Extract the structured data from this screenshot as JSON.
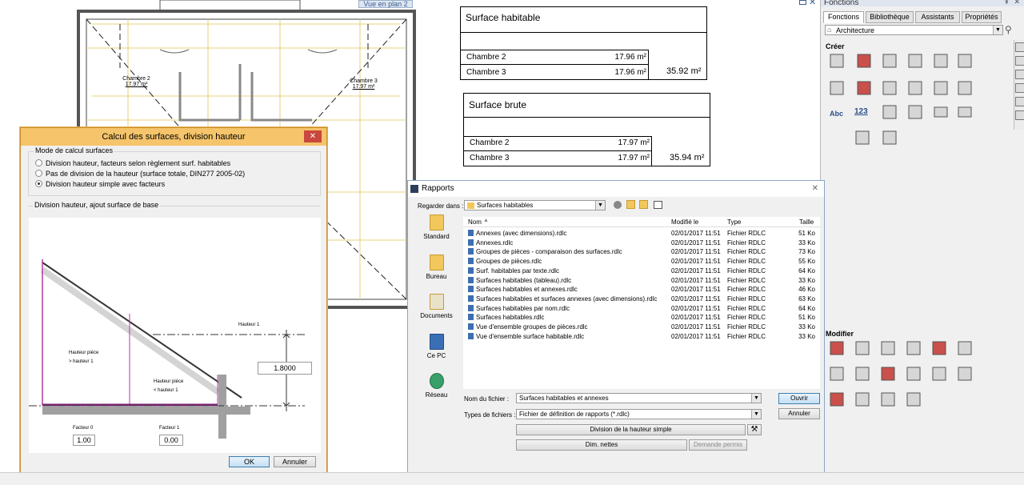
{
  "cad": {
    "view_tag": "Vue en plan 2",
    "rooms": [
      {
        "name": "Chambre 2",
        "area": "17.97 m²"
      },
      {
        "name": "Chambre 3",
        "area": "17.97 m²"
      }
    ],
    "table_habitable": {
      "title": "Surface habitable",
      "rows": [
        {
          "label": "Chambre 2",
          "value": "17.96 m²"
        },
        {
          "label": "Chambre 3",
          "value": "17.96 m²"
        }
      ],
      "total": "35.92 m²"
    },
    "table_brute": {
      "title": "Surface brute",
      "rows": [
        {
          "label": "Chambre 2",
          "value": "17.97 m²"
        },
        {
          "label": "Chambre 3",
          "value": "17.97 m²"
        }
      ],
      "total": "35.94 m²"
    }
  },
  "panel": {
    "title": "Fonctions",
    "tabs": [
      "Fonctions",
      "Bibliothèque",
      "Assistants",
      "Propriétés"
    ],
    "category": "Architecture",
    "create_label": "Créer",
    "modify_label": "Modifier",
    "abc_label": "Abc",
    "num_label": "123"
  },
  "dialog1": {
    "title": "Calcul des surfaces, division hauteur",
    "mode_group": "Mode de calcul surfaces",
    "options": [
      "Division hauteur, facteurs selon règlement surf. habitables",
      "Pas de division de la hauteur (surface totale, DIN277 2005-02)",
      "Division hauteur simple avec facteurs"
    ],
    "selected_option": 2,
    "group2": "Division hauteur, ajout surface de base",
    "hauteur1_label": "Hauteur 1",
    "hauteur1_value": "1.8000",
    "piece_gt_label1": "Hauteur pièce",
    "piece_gt_label2": "> hauteur 1",
    "piece_lt_label1": "Hauteur pièce",
    "piece_lt_label2": "< hauteur 1",
    "facteur0_label": "Facteur 0",
    "facteur0_value": "1.00",
    "facteur1_label": "Facteur 1",
    "facteur1_value": "0.00",
    "ok": "OK",
    "cancel": "Annuler"
  },
  "dialog2": {
    "title": "Rapports",
    "look_in_label": "Regarder dans :",
    "look_in_value": "Surfaces habitables",
    "places": [
      "Standard",
      "Bureau",
      "Documents",
      "Ce PC",
      "Réseau"
    ],
    "columns": [
      "Nom",
      "Modifié le",
      "Type",
      "Taille"
    ],
    "files": [
      {
        "name": "Annexes (avec dimensions).rdlc",
        "date": "02/01/2017 11:51",
        "type": "Fichier RDLC",
        "size": "51 Ko"
      },
      {
        "name": "Annexes.rdlc",
        "date": "02/01/2017 11:51",
        "type": "Fichier RDLC",
        "size": "33 Ko"
      },
      {
        "name": "Groupes de pièces - comparaison des surfaces.rdlc",
        "date": "02/01/2017 11:51",
        "type": "Fichier RDLC",
        "size": "73 Ko"
      },
      {
        "name": "Groupes de pièces.rdlc",
        "date": "02/01/2017 11:51",
        "type": "Fichier RDLC",
        "size": "55 Ko"
      },
      {
        "name": "Surf. habitables par texte.rdlc",
        "date": "02/01/2017 11:51",
        "type": "Fichier RDLC",
        "size": "64 Ko"
      },
      {
        "name": "Surfaces habitables (tableau).rdlc",
        "date": "02/01/2017 11:51",
        "type": "Fichier RDLC",
        "size": "33 Ko"
      },
      {
        "name": "Surfaces habitables et annexes.rdlc",
        "date": "02/01/2017 11:51",
        "type": "Fichier RDLC",
        "size": "46 Ko"
      },
      {
        "name": "Surfaces habitables et surfaces annexes (avec dimensions).rdlc",
        "date": "02/01/2017 11:51",
        "type": "Fichier RDLC",
        "size": "63 Ko"
      },
      {
        "name": "Surfaces habitables par nom.rdlc",
        "date": "02/01/2017 11:51",
        "type": "Fichier RDLC",
        "size": "64 Ko"
      },
      {
        "name": "Surfaces habitables.rdlc",
        "date": "02/01/2017 11:51",
        "type": "Fichier RDLC",
        "size": "51 Ko"
      },
      {
        "name": "Vue d'ensemble groupes de pièces.rdlc",
        "date": "02/01/2017 11:51",
        "type": "Fichier RDLC",
        "size": "33 Ko"
      },
      {
        "name": "Vue d'ensemble surface habitable.rdlc",
        "date": "02/01/2017 11:51",
        "type": "Fichier RDLC",
        "size": "33 Ko"
      }
    ],
    "filename_label": "Nom du fichier :",
    "filename_value": "Surfaces habitables et annexes",
    "filetype_label": "Types de fichiers :",
    "filetype_value": "Fichier de définition de rapports (*.rdlc)",
    "open": "Ouvrir",
    "cancel": "Annuler",
    "btn_division": "Division de la hauteur simple",
    "btn_dim": "Dim. nettes",
    "btn_demande": "Demande permis"
  }
}
